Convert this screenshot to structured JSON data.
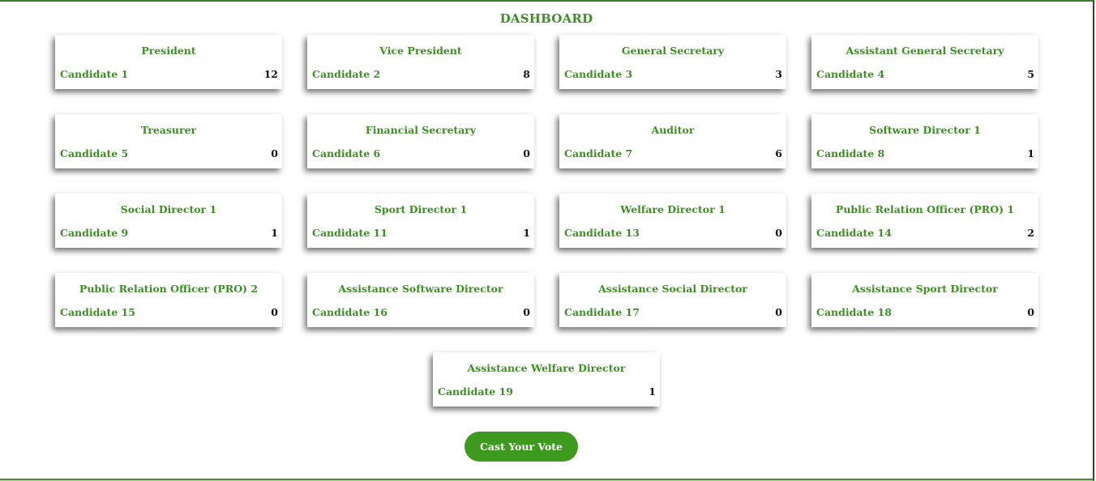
{
  "dashboard": {
    "title": "DASHBOARD",
    "cards": [
      {
        "position": "President",
        "candidate": "Candidate 1",
        "votes": "12"
      },
      {
        "position": "Vice President",
        "candidate": "Candidate 2",
        "votes": "8"
      },
      {
        "position": "General Secretary",
        "candidate": "Candidate 3",
        "votes": "3"
      },
      {
        "position": "Assistant General Secretary",
        "candidate": "Candidate 4",
        "votes": "5"
      },
      {
        "position": "Treasurer",
        "candidate": "Candidate 5",
        "votes": "0"
      },
      {
        "position": "Financial Secretary",
        "candidate": "Candidate 6",
        "votes": "0"
      },
      {
        "position": "Auditor",
        "candidate": "Candidate 7",
        "votes": "6"
      },
      {
        "position": "Software Director 1",
        "candidate": "Candidate 8",
        "votes": "1"
      },
      {
        "position": "Social Director 1",
        "candidate": "Candidate 9",
        "votes": "1"
      },
      {
        "position": "Sport Director 1",
        "candidate": "Candidate 11",
        "votes": "1"
      },
      {
        "position": "Welfare Director 1",
        "candidate": "Candidate 13",
        "votes": "0"
      },
      {
        "position": "Public Relation Officer (PRO) 1",
        "candidate": "Candidate 14",
        "votes": "2"
      },
      {
        "position": "Public Relation Officer (PRO) 2",
        "candidate": "Candidate 15",
        "votes": "0"
      },
      {
        "position": "Assistance Software Director",
        "candidate": "Candidate 16",
        "votes": "0"
      },
      {
        "position": "Assistance Social Director",
        "candidate": "Candidate 17",
        "votes": "0"
      },
      {
        "position": "Assistance Sport Director",
        "candidate": "Candidate 18",
        "votes": "0"
      },
      {
        "position": "Assistance Welfare Director",
        "candidate": "Candidate 19",
        "votes": "1"
      }
    ],
    "cast_vote_label": "Cast Your Vote"
  },
  "colors": {
    "accent_green": "#3e8e26",
    "button_green": "#3e9a1f",
    "vote_count": "#111111"
  }
}
